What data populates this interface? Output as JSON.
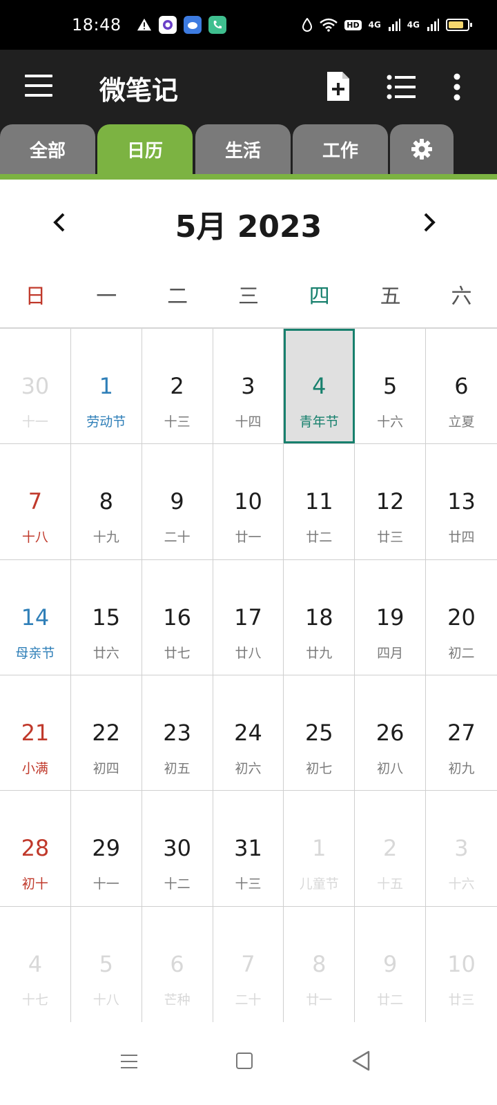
{
  "status_bar": {
    "time": "18:48",
    "wifi_label": "HD",
    "signal1_label": "4G",
    "signal2_label": "4G",
    "battery_level": 0.8
  },
  "app_bar": {
    "title": "微笔记",
    "icons": [
      "menu-icon",
      "new-note-icon",
      "list-icon",
      "more-icon"
    ]
  },
  "tabs": [
    {
      "label": "全部",
      "active": false
    },
    {
      "label": "日历",
      "active": true
    },
    {
      "label": "生活",
      "active": false
    },
    {
      "label": "工作",
      "active": false
    },
    {
      "label": "",
      "icon": "gear-icon",
      "active": false
    }
  ],
  "calendar": {
    "month_title": "5月 2023",
    "weekdays": [
      "日",
      "一",
      "二",
      "三",
      "四",
      "五",
      "六"
    ],
    "weeks": [
      [
        {
          "num": "30",
          "sub": "十一",
          "type": "other"
        },
        {
          "num": "1",
          "sub": "劳动节",
          "type": "holiday"
        },
        {
          "num": "2",
          "sub": "十三",
          "type": "normal"
        },
        {
          "num": "3",
          "sub": "十四",
          "type": "normal"
        },
        {
          "num": "4",
          "sub": "青年节",
          "type": "selected"
        },
        {
          "num": "5",
          "sub": "十六",
          "type": "normal"
        },
        {
          "num": "6",
          "sub": "立夏",
          "type": "normal"
        }
      ],
      [
        {
          "num": "7",
          "sub": "十八",
          "type": "sun"
        },
        {
          "num": "8",
          "sub": "十九",
          "type": "normal"
        },
        {
          "num": "9",
          "sub": "二十",
          "type": "normal"
        },
        {
          "num": "10",
          "sub": "廿一",
          "type": "normal"
        },
        {
          "num": "11",
          "sub": "廿二",
          "type": "normal"
        },
        {
          "num": "12",
          "sub": "廿三",
          "type": "normal"
        },
        {
          "num": "13",
          "sub": "廿四",
          "type": "normal"
        }
      ],
      [
        {
          "num": "14",
          "sub": "母亲节",
          "type": "holiday"
        },
        {
          "num": "15",
          "sub": "廿六",
          "type": "normal"
        },
        {
          "num": "16",
          "sub": "廿七",
          "type": "normal"
        },
        {
          "num": "17",
          "sub": "廿八",
          "type": "normal"
        },
        {
          "num": "18",
          "sub": "廿九",
          "type": "normal"
        },
        {
          "num": "19",
          "sub": "四月",
          "type": "normal"
        },
        {
          "num": "20",
          "sub": "初二",
          "type": "normal"
        }
      ],
      [
        {
          "num": "21",
          "sub": "小满",
          "type": "sun"
        },
        {
          "num": "22",
          "sub": "初四",
          "type": "normal"
        },
        {
          "num": "23",
          "sub": "初五",
          "type": "normal"
        },
        {
          "num": "24",
          "sub": "初六",
          "type": "normal"
        },
        {
          "num": "25",
          "sub": "初七",
          "type": "normal"
        },
        {
          "num": "26",
          "sub": "初八",
          "type": "normal"
        },
        {
          "num": "27",
          "sub": "初九",
          "type": "normal"
        }
      ],
      [
        {
          "num": "28",
          "sub": "初十",
          "type": "sun"
        },
        {
          "num": "29",
          "sub": "十一",
          "type": "normal"
        },
        {
          "num": "30",
          "sub": "十二",
          "type": "normal"
        },
        {
          "num": "31",
          "sub": "十三",
          "type": "normal"
        },
        {
          "num": "1",
          "sub": "儿童节",
          "type": "other"
        },
        {
          "num": "2",
          "sub": "十五",
          "type": "other"
        },
        {
          "num": "3",
          "sub": "十六",
          "type": "other"
        }
      ],
      [
        {
          "num": "4",
          "sub": "十七",
          "type": "other"
        },
        {
          "num": "5",
          "sub": "十八",
          "type": "other"
        },
        {
          "num": "6",
          "sub": "芒种",
          "type": "other"
        },
        {
          "num": "7",
          "sub": "二十",
          "type": "other"
        },
        {
          "num": "8",
          "sub": "廿一",
          "type": "other"
        },
        {
          "num": "9",
          "sub": "廿二",
          "type": "other"
        },
        {
          "num": "10",
          "sub": "廿三",
          "type": "other"
        }
      ]
    ]
  },
  "colors": {
    "accent_green": "#7cb342",
    "selected_teal": "#17806d",
    "sunday_red": "#c0392b",
    "holiday_blue": "#2f7fb8",
    "app_bar_bg": "#202020"
  }
}
